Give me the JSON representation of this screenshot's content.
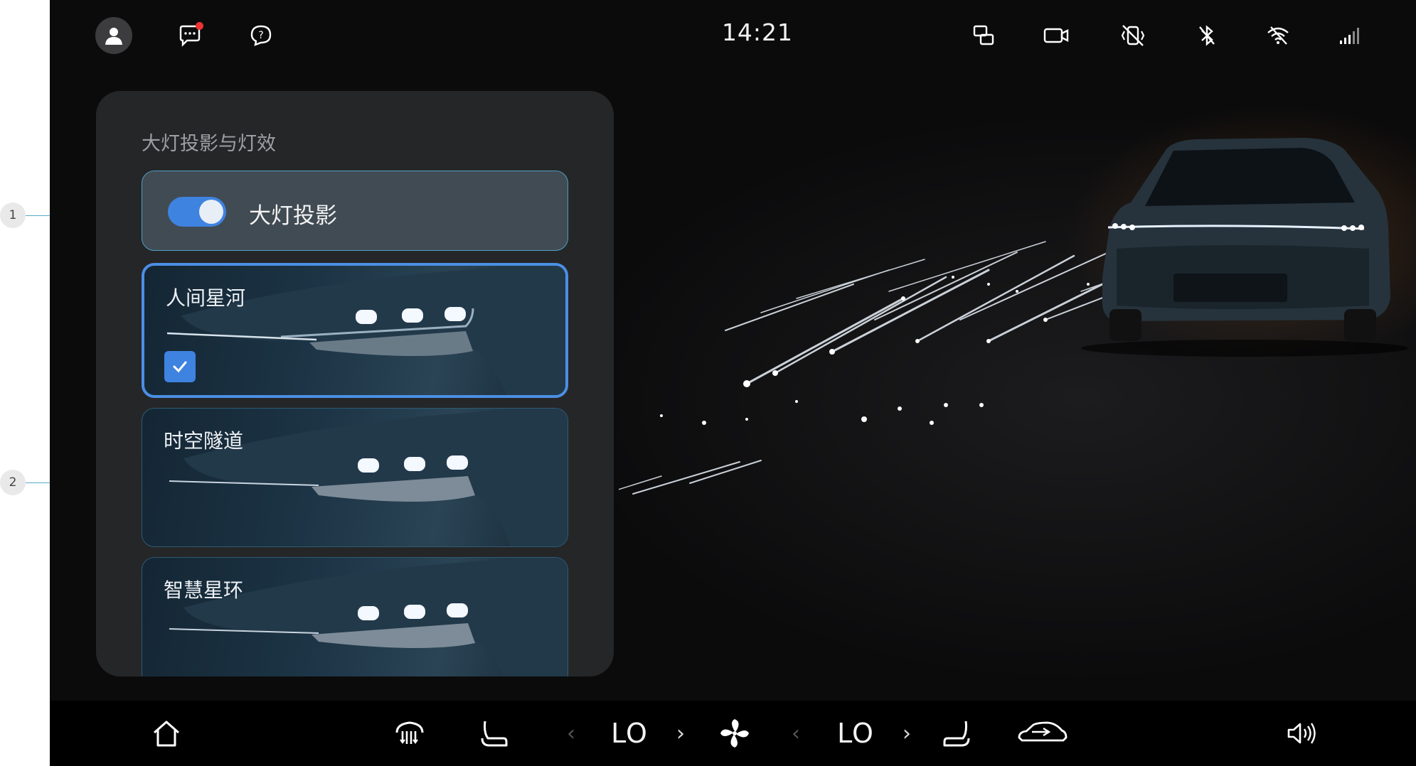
{
  "annotations": [
    "1",
    "2"
  ],
  "status_bar": {
    "time": "14:21",
    "left_icons": [
      "user-avatar-icon",
      "message-icon",
      "help-icon"
    ],
    "right_icons": [
      "screen-mirror-icon",
      "dashcam-icon",
      "vibration-off-icon",
      "bluetooth-off-icon",
      "wifi-off-icon",
      "cellular-signal-icon"
    ],
    "message_badge_color": "#e33333"
  },
  "panel": {
    "title": "大灯投影与灯效",
    "toggle": {
      "label": "大灯投影",
      "on": true
    },
    "effects": [
      {
        "label": "人间星河",
        "selected": true
      },
      {
        "label": "时空隧道",
        "selected": false
      },
      {
        "label": "智慧星环",
        "selected": false
      }
    ]
  },
  "dock": {
    "left_temp": "LO",
    "right_temp": "LO",
    "icons": [
      "home-icon",
      "rear-defrost-icon",
      "seat-heat-icon",
      "fan-icon",
      "seat-icon",
      "car-airflow-icon",
      "volume-icon"
    ]
  },
  "colors": {
    "accent": "#3f83e0",
    "panel_bg": "#252628",
    "screen_bg": "#0f0f10",
    "toggle_row_bg": "#414b53",
    "annotation_line": "#56a9c8"
  }
}
